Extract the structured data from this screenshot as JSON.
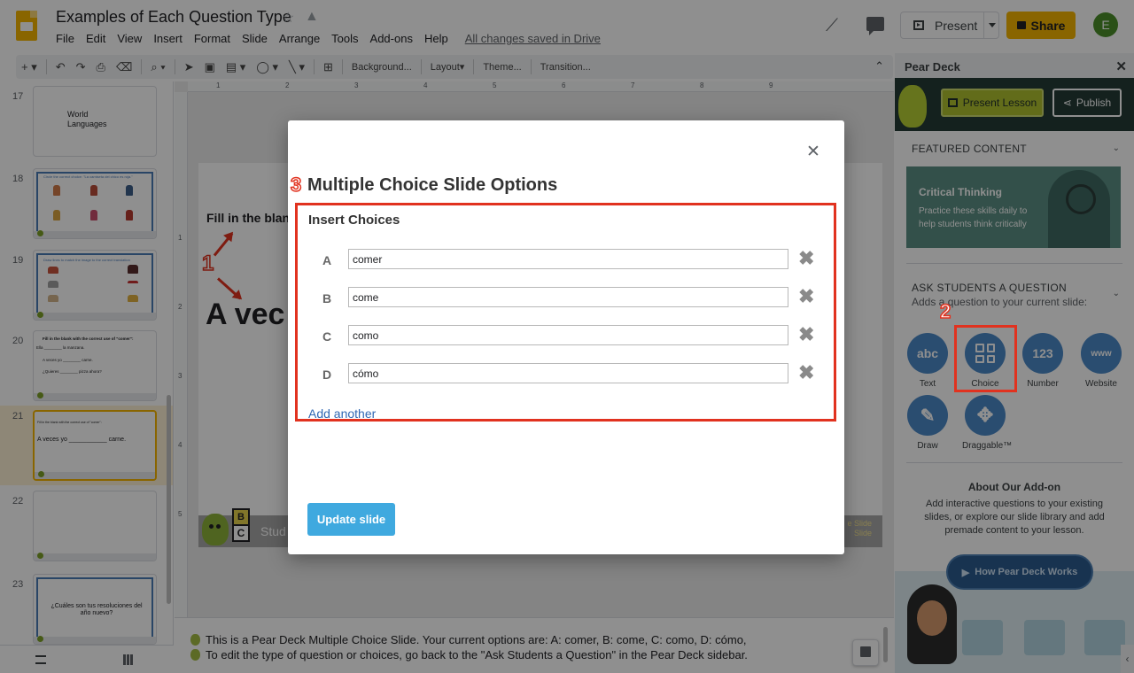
{
  "app": {
    "doc_title": "Examples of Each Question Type",
    "menu": [
      "File",
      "Edit",
      "View",
      "Insert",
      "Format",
      "Slide",
      "Arrange",
      "Tools",
      "Add-ons",
      "Help"
    ],
    "saved_status": "All changes saved in Drive",
    "present_label": "Present",
    "share_label": "Share",
    "avatar_initial": "E"
  },
  "toolbar": {
    "background": "Background...",
    "layout": "Layout▾",
    "theme": "Theme...",
    "transition": "Transition..."
  },
  "filmstrip": {
    "slides": [
      {
        "num": "17",
        "text": "World\nLanguages"
      },
      {
        "num": "18",
        "text": "Circle the correct choice: \"La camiseta del chico es roja.\""
      },
      {
        "num": "19",
        "text": "Draw lines to match the image to the correct translation"
      },
      {
        "num": "20",
        "text": "Fill in the blank with the correct use of \"comer\":",
        "lines": [
          "Ella ________ la manzana.",
          "A veces yo ________ carne.",
          "¿Quieres ________ pizza ahora?"
        ]
      },
      {
        "num": "21",
        "text": "A veces yo ___________ carne.",
        "small": "Fill in the blank with the correct use of \"comer\":"
      },
      {
        "num": "22",
        "text": ""
      },
      {
        "num": "23",
        "text": "¿Cuáles son tus resoluciones del año nuevo?"
      }
    ]
  },
  "ruler": {
    "h": [
      "1",
      "2",
      "3",
      "4",
      "5",
      "6",
      "7",
      "8",
      "9"
    ],
    "v": [
      "1",
      "2",
      "3",
      "4",
      "5"
    ]
  },
  "slide": {
    "fill_text": "Fill in the blan",
    "big_text": "A vec",
    "footer_label": "Stud",
    "footer_right_1": "e Slide",
    "footer_right_2": "Slide",
    "block_b": "B",
    "block_c": "C"
  },
  "annotations": {
    "one": "1",
    "two": "2",
    "three": "3"
  },
  "notes": {
    "line1": "This is a Pear Deck Multiple Choice Slide. Your current options are: A: comer, B: come, C: como, D: cómo,",
    "line2": "To edit the type of question or choices, go back to the \"Ask Students a Question\" in the Pear Deck sidebar."
  },
  "sidebar": {
    "title": "Pear Deck",
    "present_lesson": "Present Lesson",
    "publish": "Publish",
    "featured_title": "FEATURED CONTENT",
    "card_title": "Critical Thinking",
    "card_desc": "Practice these skills daily to help students think critically",
    "ask_title": "ASK STUDENTS A QUESTION",
    "ask_subtitle": "Adds a question to your current slide:",
    "question_types": [
      {
        "label": "Text",
        "glyph": "abc"
      },
      {
        "label": "Choice",
        "glyph": ""
      },
      {
        "label": "Number",
        "glyph": "123"
      },
      {
        "label": "Website",
        "glyph": "www"
      },
      {
        "label": "Draw",
        "glyph": "✎"
      },
      {
        "label": "Draggable™",
        "glyph": "✥"
      }
    ],
    "about_title": "About Our Add-on",
    "about_text": "Add interactive questions to your existing slides, or explore our slide library and add premade content to your lesson.",
    "how_button": "How Pear Deck Works"
  },
  "modal": {
    "title": "Multiple Choice Slide Options",
    "section": "Insert Choices",
    "choices": [
      {
        "letter": "A",
        "value": "comer"
      },
      {
        "letter": "B",
        "value": "come"
      },
      {
        "letter": "C",
        "value": "como"
      },
      {
        "letter": "D",
        "value": "cómo"
      }
    ],
    "add_another": "Add another",
    "update_button": "Update slide"
  },
  "colors": {
    "accent_yellow": "#f4b400",
    "annotation_red": "#e1321f",
    "update_blue": "#3fa9df",
    "pear_green": "#afc12f",
    "question_blue": "#4b89c8"
  }
}
